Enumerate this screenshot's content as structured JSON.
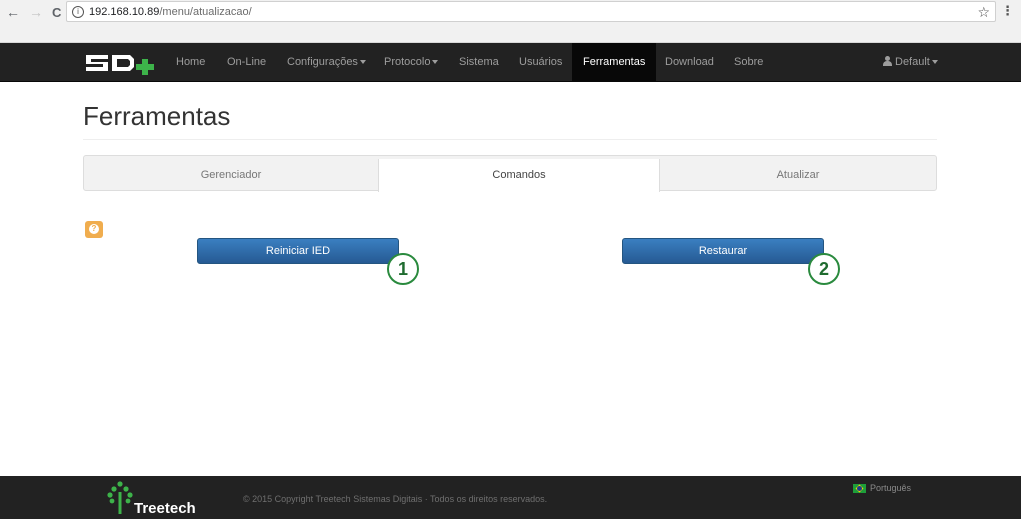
{
  "browser": {
    "back_icon": "←",
    "forward_icon": "→",
    "reload_icon": "C",
    "info_icon": "i",
    "url_host": "192.168.10.89",
    "url_path": "/menu/atualizacao/",
    "star_icon": "☆",
    "menu_icon": "⋮"
  },
  "navbar": {
    "items": [
      {
        "label": "Home"
      },
      {
        "label": "On-Line"
      },
      {
        "label": "Configurações"
      },
      {
        "label": "Protocolo"
      },
      {
        "label": "Sistema"
      },
      {
        "label": "Usuários"
      },
      {
        "label": "Ferramentas"
      },
      {
        "label": "Download"
      },
      {
        "label": "Sobre"
      }
    ],
    "user_label": "Default"
  },
  "page": {
    "title": "Ferramentas",
    "tabs": [
      {
        "label": "Gerenciador"
      },
      {
        "label": "Comandos"
      },
      {
        "label": "Atualizar"
      }
    ],
    "help_symbol": "?",
    "buttons": {
      "restart": "Reiniciar IED",
      "restore": "Restaurar"
    },
    "markers": [
      "1",
      "2"
    ]
  },
  "footer": {
    "brand": "Treetech",
    "copyright": "© 2015 Copyright Treetech Sistemas Digitais · Todos os direitos reservados.",
    "language": "Português"
  },
  "colors": {
    "navbar": "#222222",
    "button": "#337ab7",
    "help": "#f0ad4e",
    "marker": "#2a8a3e",
    "logo_green": "#3db34a"
  }
}
